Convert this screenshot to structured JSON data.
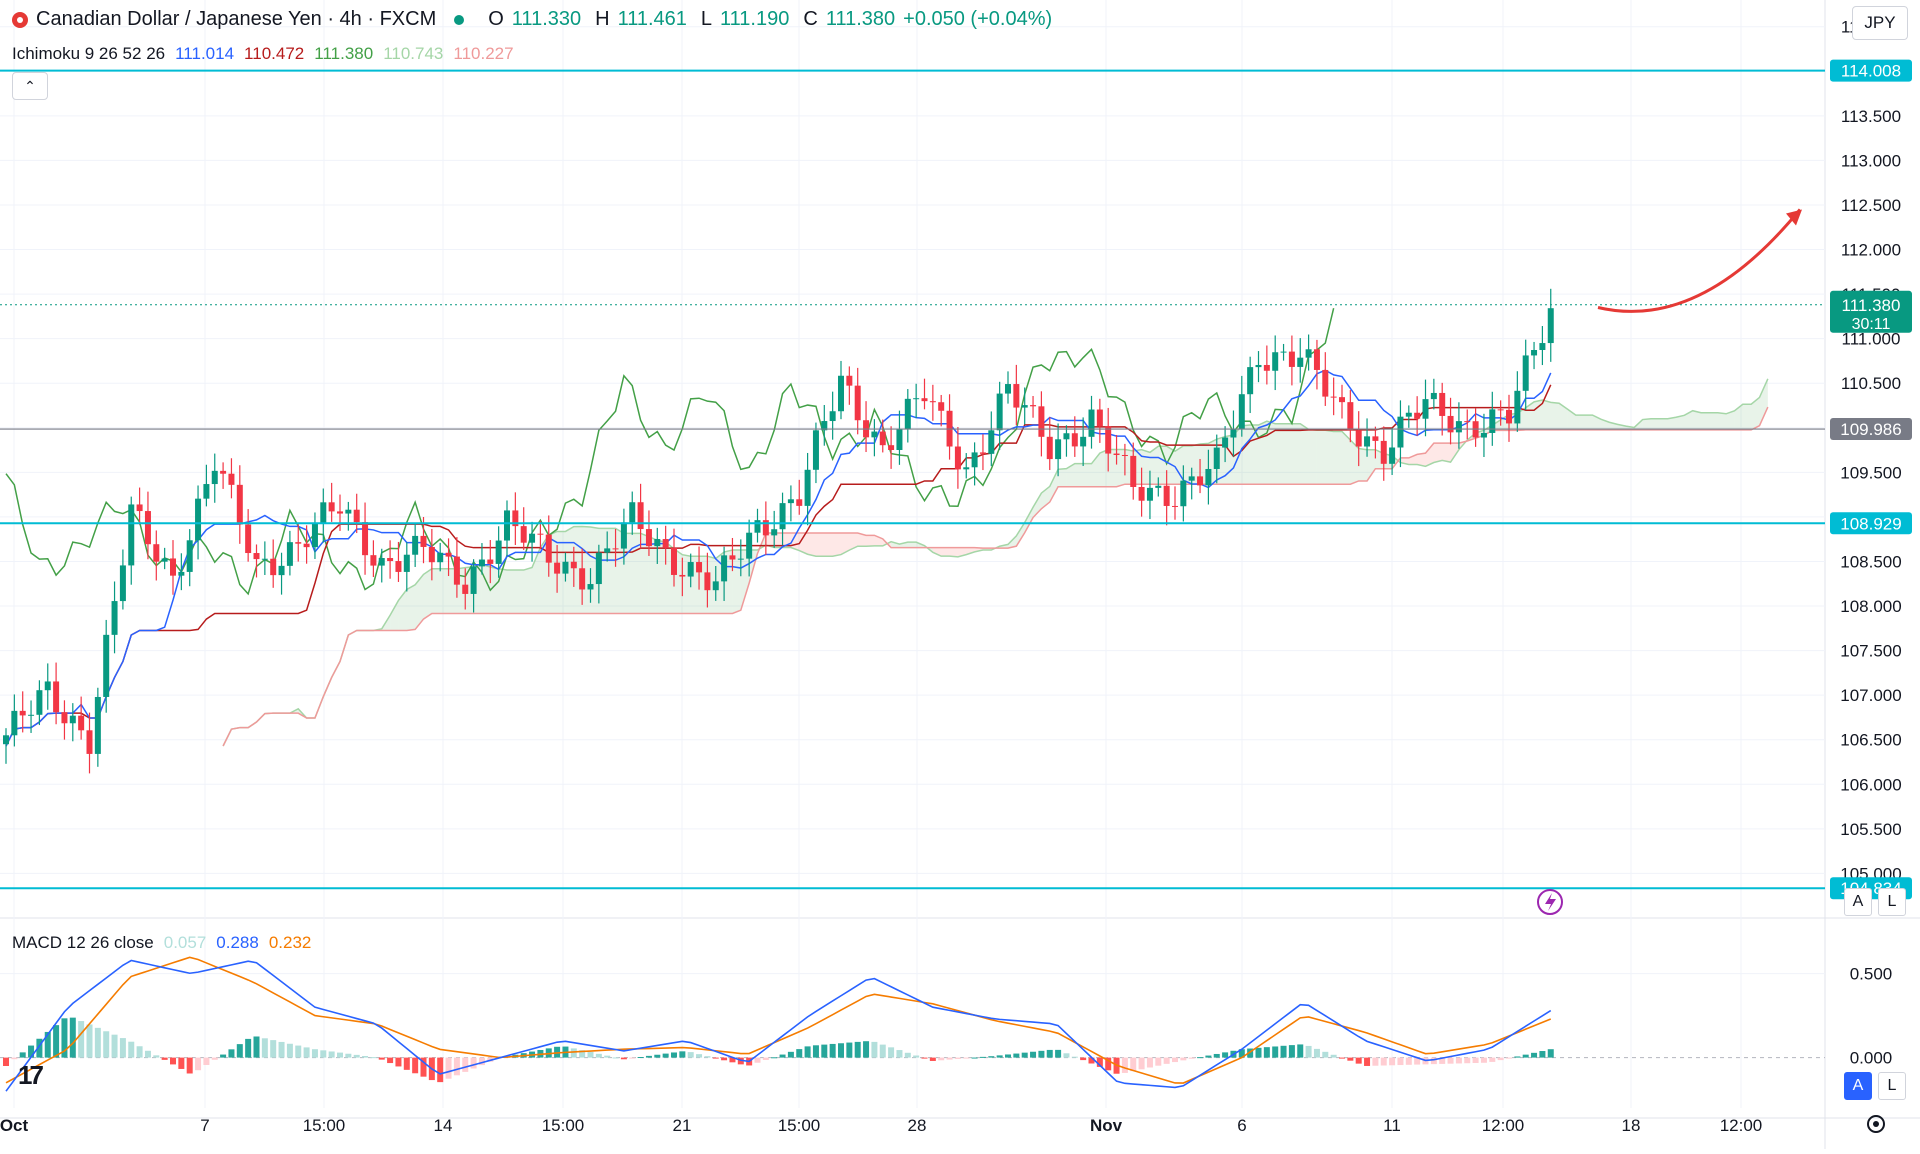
{
  "header": {
    "symbol_title": "Canadian Dollar / Japanese Yen · 4h · FXCM",
    "open_label": "O",
    "open": "111.330",
    "high_label": "H",
    "high": "111.461",
    "low_label": "L",
    "low": "111.190",
    "close_label": "C",
    "close": "111.380",
    "change": "+0.050 (+0.04%)",
    "currency": "JPY"
  },
  "ichimoku_legend": {
    "name": "Ichimoku 9 26 52 26",
    "values": [
      "111.014",
      "110.472",
      "111.380",
      "110.743",
      "110.227"
    ],
    "colors": [
      "#2962ff",
      "#b71c1c",
      "#43a047",
      "#a5d6a7",
      "#ef9a9a"
    ]
  },
  "macd_legend": {
    "name": "MACD 12 26 close",
    "values": [
      "0.057",
      "0.288",
      "0.232"
    ],
    "colors": [
      "#b2dfdb",
      "#2962ff",
      "#f57c00"
    ]
  },
  "price_labels": {
    "current_price": "111.380",
    "countdown": "30:11"
  },
  "levels": [
    {
      "value": "114.008",
      "color": "#00bcd4"
    },
    {
      "value": "109.986",
      "color": "#787b86"
    },
    {
      "value": "108.929",
      "color": "#00bcd4"
    },
    {
      "value": "104.834",
      "color": "#00bcd4"
    }
  ],
  "buttons": {
    "auto_label": "A",
    "log_label": "L",
    "macd_auto_label": "A",
    "macd_log_label": "L",
    "collapse_label": "⌃"
  },
  "icons": [
    "tradingview-logo-icon",
    "lightning-icon",
    "settings-gear-icon",
    "chevron-up-icon",
    "canada-flag-icon"
  ],
  "chart_data": [
    {
      "type": "candlestick",
      "title": "Canadian Dollar / Japanese Yen · 4h · FXCM",
      "ylim": [
        104.5,
        114.8
      ],
      "yticks": [
        105.0,
        105.5,
        106.0,
        106.5,
        107.0,
        107.5,
        108.0,
        108.5,
        109.0,
        109.5,
        110.0,
        110.5,
        111.0,
        111.5,
        112.0,
        112.5,
        113.0,
        113.5,
        114.5
      ],
      "ytick_labels": [
        "105.000",
        "105.500",
        "106.000",
        "106.500",
        "107.000",
        "107.500",
        "108.000",
        "108.500",
        "",
        "109.500",
        "",
        "110.500",
        "111.000",
        "111.500",
        "112.000",
        "112.500",
        "113.000",
        "113.500",
        "114.500"
      ],
      "xtick_labels": [
        "Oct",
        "7",
        "15:00",
        "14",
        "15:00",
        "21",
        "15:00",
        "28",
        "Nov",
        "6",
        "11",
        "12:00",
        "18",
        "12:00"
      ],
      "key_prices": [
        106.55,
        107.0,
        106.55,
        109.0,
        108.35,
        109.6,
        108.45,
        108.7,
        109.1,
        108.5,
        108.6,
        108.3,
        108.9,
        108.55,
        108.35,
        108.95,
        108.55,
        108.2,
        108.9,
        109.25,
        110.5,
        109.8,
        110.35,
        109.55,
        110.4,
        109.8,
        110.1,
        109.3,
        109.3,
        109.55,
        110.85,
        110.8,
        110.15,
        109.75,
        110.25,
        110.05,
        110.1,
        111.35
      ],
      "forecast_arrow": "up",
      "ichimoku_lines": [
        "conversion",
        "base",
        "lagging",
        "leading_a",
        "leading_b"
      ]
    },
    {
      "type": "line",
      "title": "MACD 12 26 close",
      "ylim": [
        -0.3,
        0.7
      ],
      "yticks": [
        0.0,
        0.5
      ],
      "ytick_labels": [
        "0.000",
        "0.500"
      ],
      "series": [
        {
          "name": "MACD",
          "color": "#2962ff",
          "key_values": [
            -0.2,
            0.3,
            0.58,
            0.5,
            0.58,
            0.3,
            0.2,
            -0.1,
            0.0,
            0.1,
            0.04,
            0.1,
            -0.03,
            0.25,
            0.48,
            0.3,
            0.23,
            0.2,
            -0.15,
            -0.18,
            0.05,
            0.33,
            0.1,
            -0.02,
            0.05,
            0.28
          ]
        },
        {
          "name": "Signal",
          "color": "#f57c00",
          "key_values": [
            -0.15,
            0.05,
            0.48,
            0.6,
            0.45,
            0.25,
            0.2,
            0.05,
            0.0,
            0.03,
            0.05,
            0.06,
            0.02,
            0.18,
            0.38,
            0.32,
            0.22,
            0.15,
            -0.05,
            -0.16,
            0.0,
            0.25,
            0.15,
            0.02,
            0.08,
            0.23
          ]
        }
      ]
    }
  ]
}
